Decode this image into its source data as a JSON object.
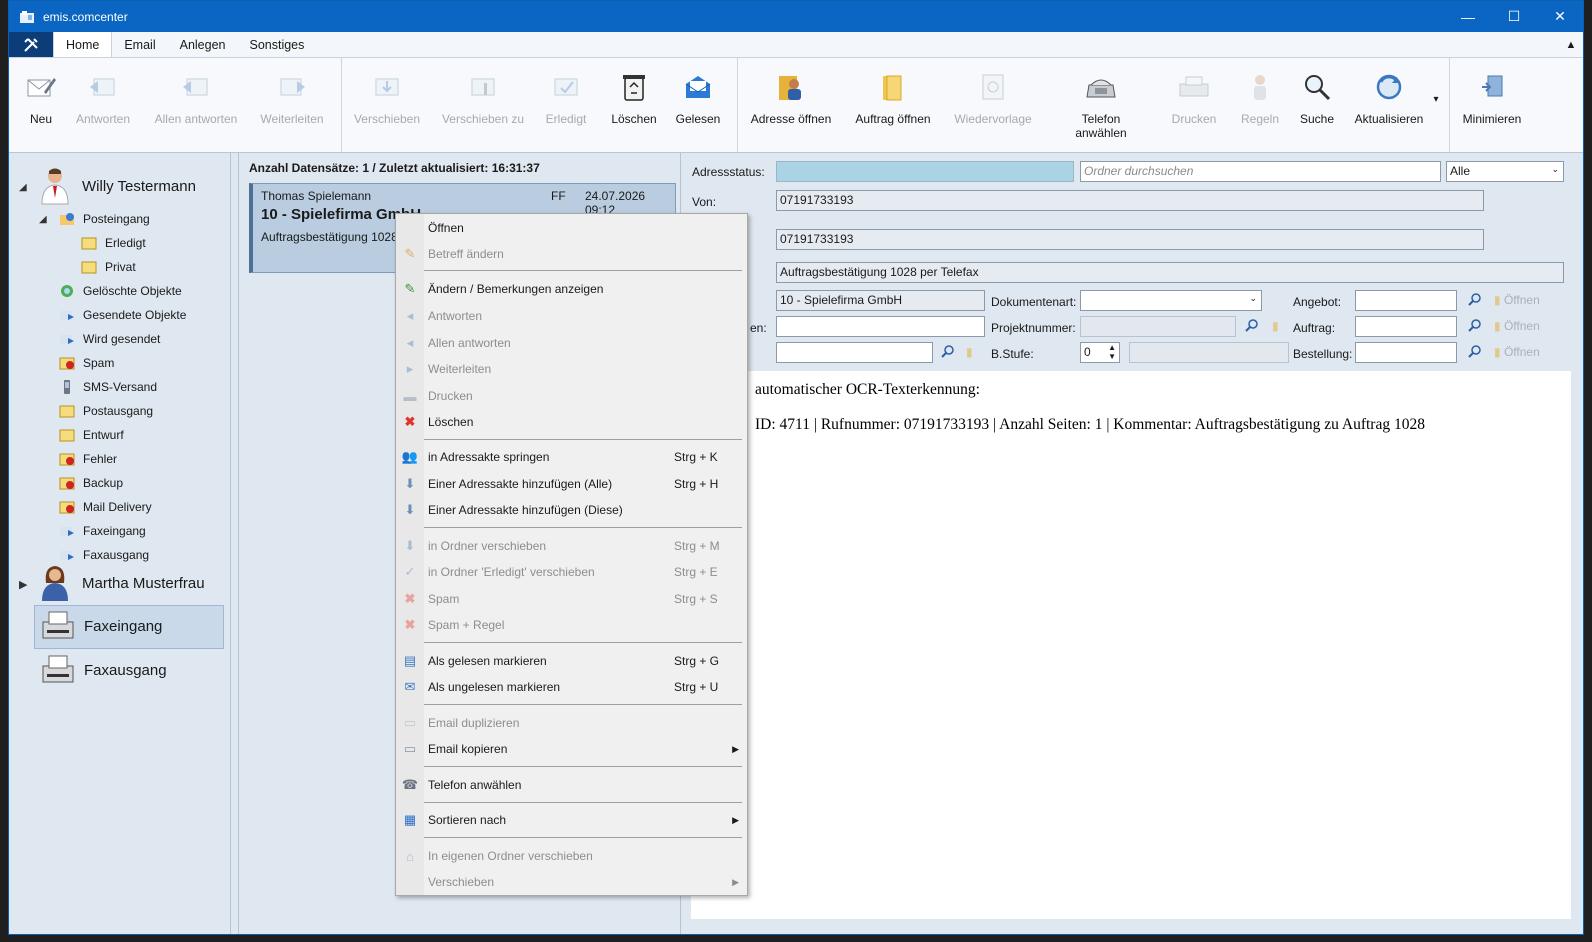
{
  "app": {
    "title": "emis.comcenter"
  },
  "window_buttons": {
    "minimize": "—",
    "maximize": "☐",
    "close": "✕"
  },
  "menu": {
    "tabs": [
      "Home",
      "Email",
      "Anlegen",
      "Sonstiges"
    ],
    "collapse": "▲"
  },
  "ribbon": {
    "buttons": [
      {
        "label": "Neu",
        "enabled": true,
        "icon": "new-mail-icon"
      },
      {
        "label": "Antworten",
        "enabled": false,
        "icon": "reply-icon"
      },
      {
        "label": "Allen antworten",
        "enabled": false,
        "icon": "reply-all-icon"
      },
      {
        "label": "Weiterleiten",
        "enabled": false,
        "icon": "forward-icon"
      },
      {
        "label": "Verschieben",
        "enabled": false,
        "icon": "move-icon"
      },
      {
        "label": "Verschieben zu",
        "enabled": false,
        "icon": "move-to-icon"
      },
      {
        "label": "Erledigt",
        "enabled": false,
        "icon": "done-icon"
      },
      {
        "label": "Löschen",
        "enabled": true,
        "icon": "recycle-bin-icon"
      },
      {
        "label": "Gelesen",
        "enabled": true,
        "icon": "read-mail-icon"
      },
      {
        "label": "Adresse öffnen",
        "enabled": true,
        "icon": "address-open-icon"
      },
      {
        "label": "Auftrag öffnen",
        "enabled": true,
        "icon": "order-folder-icon"
      },
      {
        "label": "Wiedervorlage",
        "enabled": false,
        "icon": "resubmission-icon"
      },
      {
        "label": "Telefon anwählen",
        "enabled": true,
        "icon": "telephone-icon"
      },
      {
        "label": "Drucken",
        "enabled": false,
        "icon": "printer-icon"
      },
      {
        "label": "Regeln",
        "enabled": false,
        "icon": "rules-icon"
      },
      {
        "label": "Suche",
        "enabled": true,
        "icon": "search-icon"
      },
      {
        "label": "Aktualisieren",
        "enabled": true,
        "icon": "refresh-icon"
      },
      {
        "label": "Minimieren",
        "enabled": true,
        "icon": "minimize-icon"
      }
    ],
    "more": "▾"
  },
  "sidebar": {
    "users": [
      {
        "name": "Willy Testermann",
        "expanded": true
      },
      {
        "name": "Martha Musterfrau",
        "expanded": false
      }
    ],
    "folders": [
      {
        "label": "Posteingang",
        "icon": "inbox-icon"
      },
      {
        "label": "Erledigt",
        "icon": "folder-icon"
      },
      {
        "label": "Privat",
        "icon": "folder-icon"
      },
      {
        "label": "Gelöschte Objekte",
        "icon": "recycle-icon"
      },
      {
        "label": "Gesendete Objekte",
        "icon": "sent-icon"
      },
      {
        "label": "Wird gesendet",
        "icon": "outbox-icon"
      },
      {
        "label": "Spam",
        "icon": "spam-icon"
      },
      {
        "label": "SMS-Versand",
        "icon": "sms-icon"
      },
      {
        "label": "Postausgang",
        "icon": "folder-icon"
      },
      {
        "label": "Entwurf",
        "icon": "folder-icon"
      },
      {
        "label": "Fehler",
        "icon": "error-icon"
      },
      {
        "label": "Backup",
        "icon": "backup-icon"
      },
      {
        "label": "Mail Delivery",
        "icon": "mail-delivery-icon"
      },
      {
        "label": "Faxeingang",
        "icon": "fax-in-icon"
      },
      {
        "label": "Faxausgang",
        "icon": "fax-out-icon"
      }
    ],
    "fax_groups": [
      {
        "label": "Faxeingang",
        "selected": true
      },
      {
        "label": "Faxausgang",
        "selected": false
      }
    ]
  },
  "list": {
    "header": "Anzahl Datensätze: 1 / Zuletzt aktualisiert: 16:31:37",
    "items": [
      {
        "sender": "Thomas Spielemann",
        "flag": "FF",
        "date": "24.07.2026 09:12",
        "subject": "10 - Spielefirma GmbH",
        "preview": "Auftragsbestätigung 1028"
      }
    ]
  },
  "detail": {
    "labels": {
      "adressstatus": "Adressstatus:",
      "von": "Von:",
      "dokumentenart": "Dokumentenart:",
      "angebot": "Angebot:",
      "projektnummer": "Projektnummer:",
      "auftrag": "Auftrag:",
      "bstufe": "B.Stufe:",
      "bestellung": "Bestellung:",
      "partial_label": "en:",
      "oeffnen": "Öffnen"
    },
    "search_placeholder": "Ordner durchsuchen",
    "filter": "Alle",
    "von": "07191733193",
    "an": "07191733193",
    "subject": "Auftragsbestätigung 1028 per Telefax",
    "company": "10 - Spielefirma GmbH",
    "bstufe": "0",
    "body_line1": "automatischer OCR-Texterkennung:",
    "body_line2": "ID: 4711 | Rufnummer: 07191733193 | Anzahl Seiten: 1 | Kommentar: Auftragsbestätigung zu Auftrag 1028"
  },
  "context_menu": {
    "items": [
      {
        "label": "Öffnen",
        "shortcut": "",
        "enabled": true,
        "submenu": false,
        "icon": "",
        "top": 0
      },
      {
        "label": "Betreff ändern",
        "shortcut": "",
        "enabled": false,
        "submenu": false,
        "icon": "pencil-icon"
      },
      {
        "sep": true
      },
      {
        "label": "Ändern / Bemerkungen anzeigen",
        "shortcut": "",
        "enabled": true,
        "submenu": false,
        "icon": "edit-notes-icon"
      },
      {
        "label": "Antworten",
        "shortcut": "",
        "enabled": false,
        "submenu": false,
        "icon": "reply-icon"
      },
      {
        "label": "Allen antworten",
        "shortcut": "",
        "enabled": false,
        "submenu": false,
        "icon": "reply-all-icon"
      },
      {
        "label": "Weiterleiten",
        "shortcut": "",
        "enabled": false,
        "submenu": false,
        "icon": "forward-icon"
      },
      {
        "label": "Drucken",
        "shortcut": "",
        "enabled": false,
        "submenu": false,
        "icon": "printer-icon"
      },
      {
        "label": "Löschen",
        "shortcut": "",
        "enabled": true,
        "submenu": false,
        "icon": "delete-x-icon"
      },
      {
        "sep": true
      },
      {
        "label": "in Adressakte springen",
        "shortcut": "Strg + K",
        "enabled": true,
        "submenu": false,
        "icon": "address-file-icon"
      },
      {
        "label": "Einer Adressakte hinzufügen (Alle)",
        "shortcut": "Strg + H",
        "enabled": true,
        "submenu": false,
        "icon": "add-to-file-icon"
      },
      {
        "label": "Einer Adressakte hinzufügen (Diese)",
        "shortcut": "",
        "enabled": true,
        "submenu": false,
        "icon": "add-to-file-icon"
      },
      {
        "sep": true
      },
      {
        "label": "in Ordner verschieben",
        "shortcut": "Strg + M",
        "enabled": false,
        "submenu": false,
        "icon": "move-icon"
      },
      {
        "label": "in Ordner 'Erledigt' verschieben",
        "shortcut": "Strg + E",
        "enabled": false,
        "submenu": false,
        "icon": "done-icon"
      },
      {
        "label": "Spam",
        "shortcut": "Strg + S",
        "enabled": false,
        "submenu": false,
        "icon": "spam-x-icon"
      },
      {
        "label": "Spam + Regel",
        "shortcut": "",
        "enabled": false,
        "submenu": false,
        "icon": "spam-x-icon"
      },
      {
        "sep": true
      },
      {
        "label": "Als gelesen markieren",
        "shortcut": "Strg + G",
        "enabled": true,
        "submenu": false,
        "icon": "mark-read-icon"
      },
      {
        "label": "Als ungelesen markieren",
        "shortcut": "Strg + U",
        "enabled": true,
        "submenu": false,
        "icon": "mark-unread-icon"
      },
      {
        "sep": true
      },
      {
        "label": "Email duplizieren",
        "shortcut": "",
        "enabled": false,
        "submenu": false,
        "icon": "duplicate-icon"
      },
      {
        "label": "Email kopieren",
        "shortcut": "",
        "enabled": true,
        "submenu": true,
        "icon": "copy-icon"
      },
      {
        "sep": true
      },
      {
        "label": "Telefon anwählen",
        "shortcut": "",
        "enabled": true,
        "submenu": false,
        "icon": "telephone-icon"
      },
      {
        "sep": true
      },
      {
        "label": "Sortieren nach",
        "shortcut": "",
        "enabled": true,
        "submenu": true,
        "icon": "sort-icon"
      },
      {
        "sep": true
      },
      {
        "label": "In eigenen Ordner verschieben",
        "shortcut": "",
        "enabled": false,
        "submenu": false,
        "icon": "own-folder-icon"
      },
      {
        "label": "Verschieben",
        "shortcut": "",
        "enabled": false,
        "submenu": true,
        "icon": ""
      }
    ]
  },
  "colors": {
    "titlebar": "#0a66c2",
    "adressstatus_fill": "#aad4e6",
    "selected_item": "#b9cce0"
  }
}
